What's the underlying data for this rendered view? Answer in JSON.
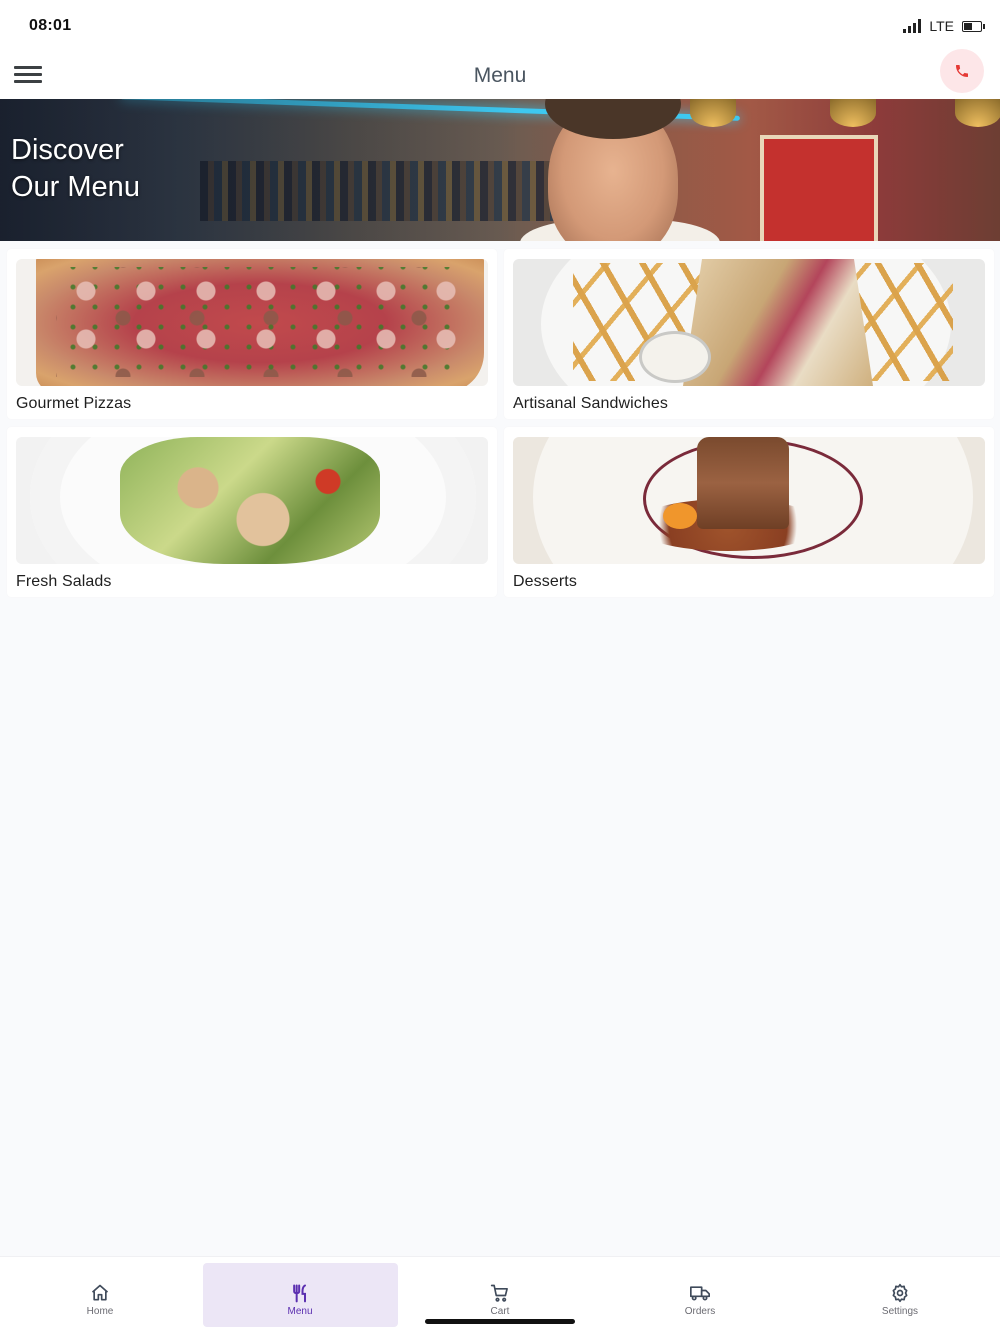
{
  "status_bar": {
    "time": "08:01",
    "network": "LTE",
    "icons": [
      "signal-icon",
      "battery-icon"
    ]
  },
  "app_bar": {
    "title": "Menu",
    "menu_icon": "hamburger-menu-icon",
    "call_icon": "phone-icon",
    "accent_color": "#e53935"
  },
  "hero": {
    "title_line1": "Discover",
    "title_line2": "Our Menu"
  },
  "categories": [
    {
      "label": "Gourmet Pizzas",
      "image": "pizza-photo"
    },
    {
      "label": "Artisanal Sandwiches",
      "image": "sandwich-photo"
    },
    {
      "label": "Fresh Salads",
      "image": "salad-photo"
    },
    {
      "label": "Desserts",
      "image": "dessert-photo"
    }
  ],
  "bottom_nav": {
    "active_color": "#5b2fb0",
    "active_background": "#ece6f6",
    "items": [
      {
        "label": "Home",
        "icon": "home-icon",
        "active": false
      },
      {
        "label": "Menu",
        "icon": "utensils-icon",
        "active": true
      },
      {
        "label": "Cart",
        "icon": "cart-icon",
        "active": false
      },
      {
        "label": "Orders",
        "icon": "delivery-truck-icon",
        "active": false
      },
      {
        "label": "Settings",
        "icon": "gear-icon",
        "active": false
      }
    ]
  }
}
